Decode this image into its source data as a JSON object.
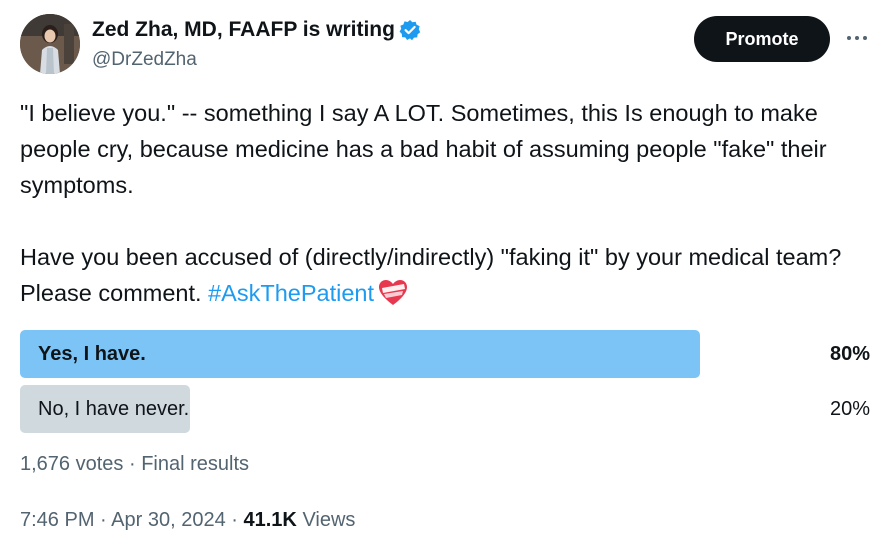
{
  "author": {
    "display_name": "Zed Zha, MD, FAAFP is writing",
    "handle": "@DrZedZha",
    "verified": true,
    "verified_color": "#1d9bf0"
  },
  "header": {
    "promote_label": "Promote",
    "more_icon": "more-horizontal-icon"
  },
  "tweet": {
    "paragraph1": "\"I believe you.\" -- something I say A LOT. Sometimes, this Is enough to make people cry, because medicine has a bad habit of assuming people \"fake\" their symptoms.",
    "paragraph2_text": "Have you been accused of (directly/indirectly) \"faking it\" by your medical team? Please comment. ",
    "hashtag": "#AskThePatient",
    "hashtag_color": "#1d9bf0",
    "emoji": "mending-heart-icon"
  },
  "poll": {
    "options": [
      {
        "label": "Yes, I have.",
        "percent_label": "80%",
        "percent": 80,
        "winner": true,
        "bar_color": "#7cc4f5"
      },
      {
        "label": "No, I have never.",
        "percent_label": "20%",
        "percent": 20,
        "winner": false,
        "bar_color": "#cfd9de"
      }
    ],
    "votes": "1,676 votes",
    "separator": "·",
    "status": "Final results"
  },
  "meta": {
    "time": "7:46 PM",
    "separator": "·",
    "date": "Apr 30, 2024",
    "views_count": "41.1K",
    "views_label": "Views"
  }
}
